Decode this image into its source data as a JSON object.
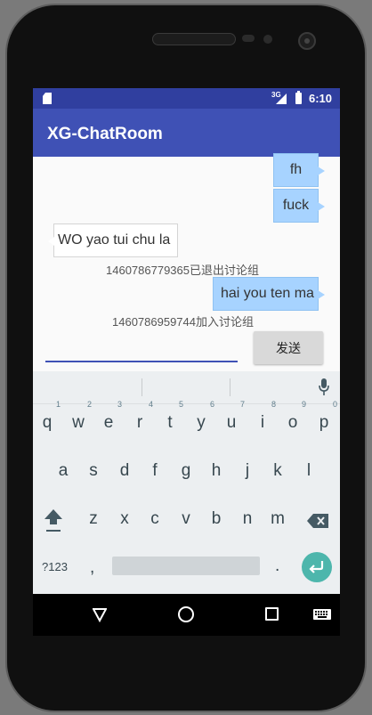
{
  "status_bar": {
    "network": "3G",
    "time": "6:10"
  },
  "app_bar": {
    "title": "XG-ChatRoom"
  },
  "chat": {
    "messages": [
      {
        "side": "right",
        "text": "fh"
      },
      {
        "side": "right",
        "text": "fuck"
      },
      {
        "side": "left",
        "text": "WO yao tui chu la"
      },
      {
        "side": "system",
        "text": "1460786779365已退出讨论组"
      },
      {
        "side": "right",
        "text": "hai you ten ma"
      },
      {
        "side": "system",
        "text": "1460786959744加入讨论组"
      }
    ]
  },
  "input": {
    "value": "",
    "send_label": "发送"
  },
  "keyboard": {
    "row1": [
      {
        "key": "q",
        "hint": "1"
      },
      {
        "key": "w",
        "hint": "2"
      },
      {
        "key": "e",
        "hint": "3"
      },
      {
        "key": "r",
        "hint": "4"
      },
      {
        "key": "t",
        "hint": "5"
      },
      {
        "key": "y",
        "hint": "6"
      },
      {
        "key": "u",
        "hint": "7"
      },
      {
        "key": "i",
        "hint": "8"
      },
      {
        "key": "o",
        "hint": "9"
      },
      {
        "key": "p",
        "hint": "0"
      }
    ],
    "row2": [
      "a",
      "s",
      "d",
      "f",
      "g",
      "h",
      "j",
      "k",
      "l"
    ],
    "row3": [
      "z",
      "x",
      "c",
      "v",
      "b",
      "n",
      "m"
    ],
    "symbols_label": "?123",
    "comma_label": ",",
    "period_label": "."
  },
  "icons": {
    "sd_card": "sd-card-icon",
    "signal": "signal-icon",
    "battery": "battery-icon",
    "mic": "mic-icon",
    "shift": "shift-icon",
    "delete": "backspace-icon",
    "enter": "enter-icon",
    "nav_back": "back-triangle-icon",
    "nav_home": "home-circle-icon",
    "nav_recent": "recent-apps-icon",
    "nav_keyboard": "keyboard-icon"
  },
  "colors": {
    "status_bar": "#303f9f",
    "app_bar": "#3f51b5",
    "sent_bubble": "#a7d3ff",
    "enter_key": "#4db6ac"
  }
}
